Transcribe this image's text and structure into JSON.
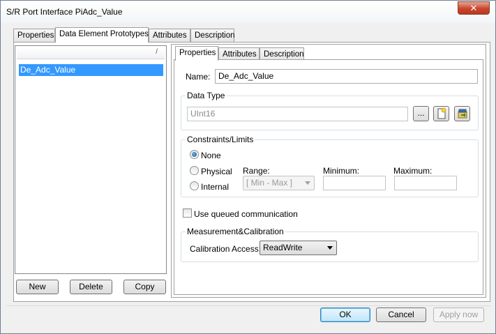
{
  "window": {
    "title": "S/R Port Interface PiAdc_Value",
    "close_glyph": "✕"
  },
  "outer_tabs": [
    "Properties",
    "Data Element Prototypes",
    "Attributes",
    "Description"
  ],
  "left_list": {
    "header_glyph": "/",
    "items": [
      "De_Adc_Value"
    ],
    "buttons": {
      "new": "New",
      "delete": "Delete",
      "copy": "Copy"
    }
  },
  "inner_tabs": [
    "Properties",
    "Attributes",
    "Description"
  ],
  "properties": {
    "name_label": "Name:",
    "name_value": "De_Adc_Value",
    "data_type": {
      "group_title": "Data Type",
      "value": "UInt16",
      "browse_label": "...",
      "new_icon": "new-document-icon",
      "goto_icon": "goto-definition-icon"
    },
    "constraints": {
      "group_title": "Constraints/Limits",
      "radio_none": "None",
      "radio_physical": "Physical",
      "radio_internal": "Internal",
      "selected": "None",
      "range_label": "Range:",
      "range_value": "[ Min - Max ]",
      "minimum_label": "Minimum:",
      "maximum_label": "Maximum:",
      "minimum_value": "",
      "maximum_value": ""
    },
    "queued_label": "Use queued communication",
    "queued_checked": false,
    "measurement": {
      "group_title": "Measurement&Calibration",
      "access_label": "Calibration Access:",
      "access_value": "ReadWrite"
    }
  },
  "footer": {
    "ok": "OK",
    "cancel": "Cancel",
    "apply": "Apply now"
  }
}
